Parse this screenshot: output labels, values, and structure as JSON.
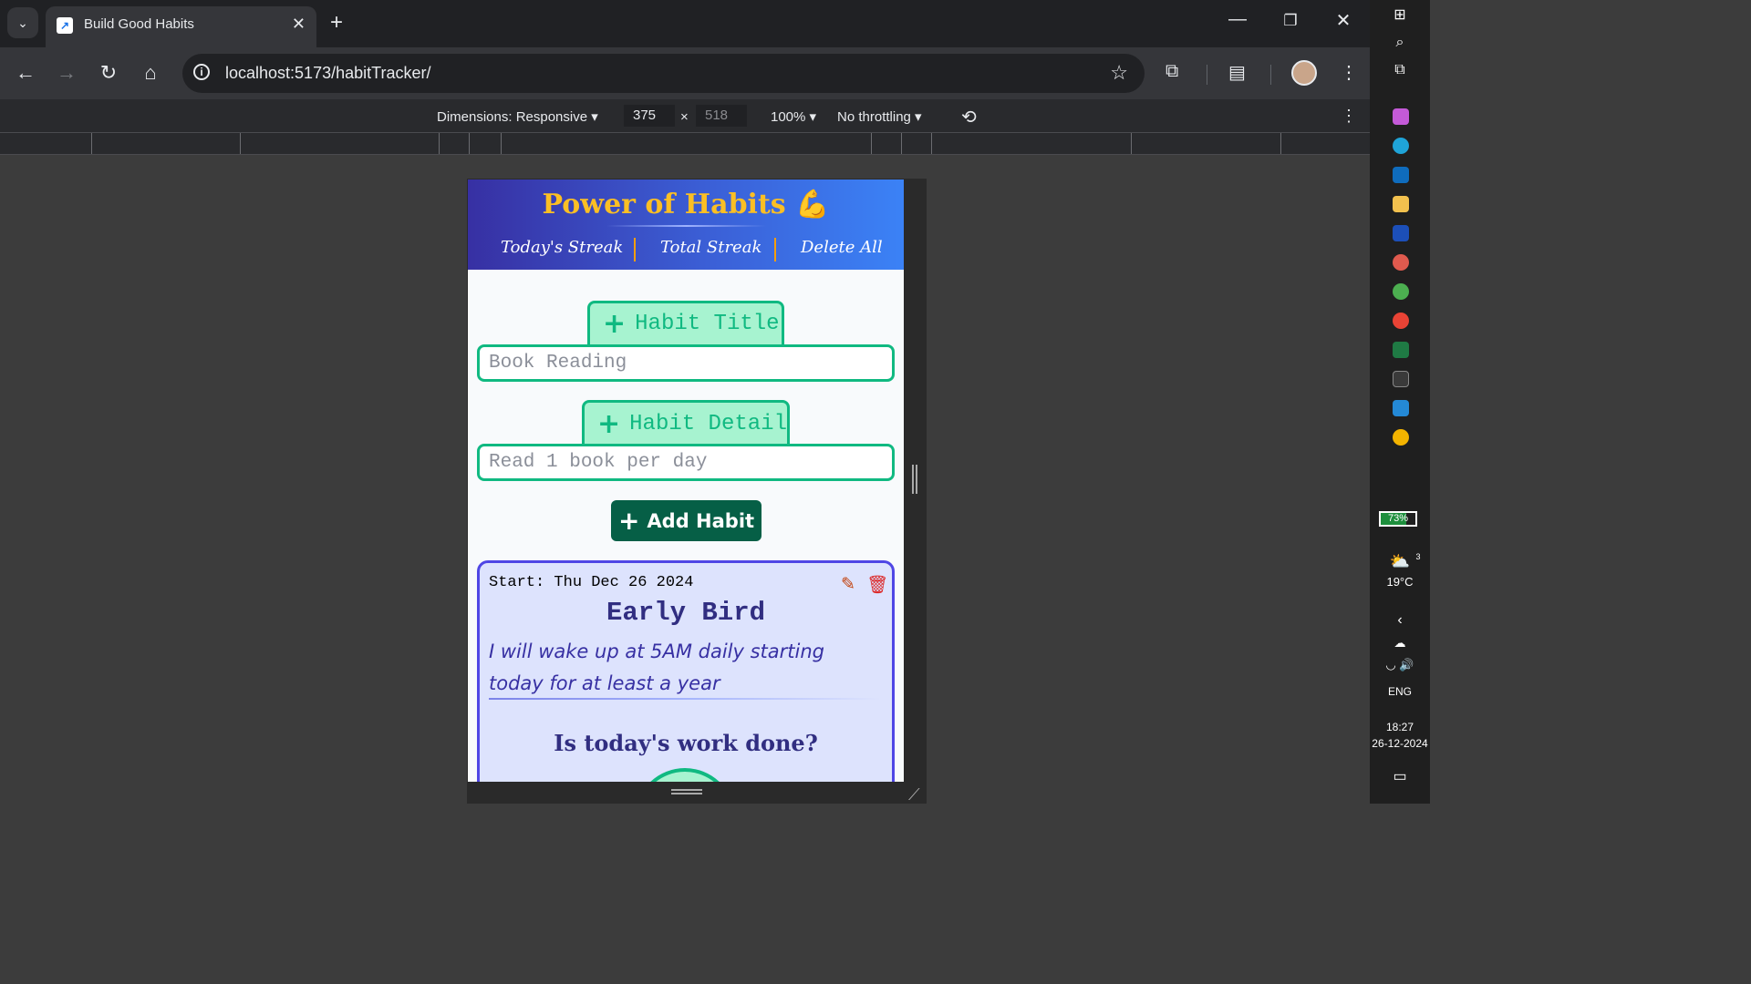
{
  "browser": {
    "tab_title": "Build Good Habits",
    "url_host": "localhost:5173",
    "url_path": "/habitTracker/"
  },
  "devtools": {
    "dimensions_label": "Dimensions: Responsive",
    "width": "375",
    "height": "518",
    "times": "×",
    "zoom": "100%",
    "throttling": "No throttling"
  },
  "app": {
    "title": "Power of Habits 💪",
    "nav": [
      "Today's Streak",
      "Total Streak",
      "Delete All"
    ],
    "title_field": {
      "label": "Habit Title",
      "placeholder": "Book Reading"
    },
    "detail_field": {
      "label": "Habit Detail",
      "placeholder": "Read 1 book per day"
    },
    "add_button": "Add Habit",
    "habit": {
      "start": "Start: Thu Dec 26 2024",
      "name": "Early Bird",
      "detail": "I will wake up at 5AM daily starting today for at least a year",
      "question": "Is today's work done?"
    }
  },
  "system": {
    "battery": "73%",
    "weather_badge": "3",
    "temperature": "19°C",
    "language": "ENG",
    "time": "18:27",
    "date": "26-12-2024"
  },
  "colors": {
    "header_gradient_start": "#3730a3",
    "header_gradient_end": "#3b82f6",
    "title_gold": "#fbbf24",
    "accent_green": "#10b981",
    "add_button": "#065f46",
    "card_border": "#4f46e5"
  }
}
